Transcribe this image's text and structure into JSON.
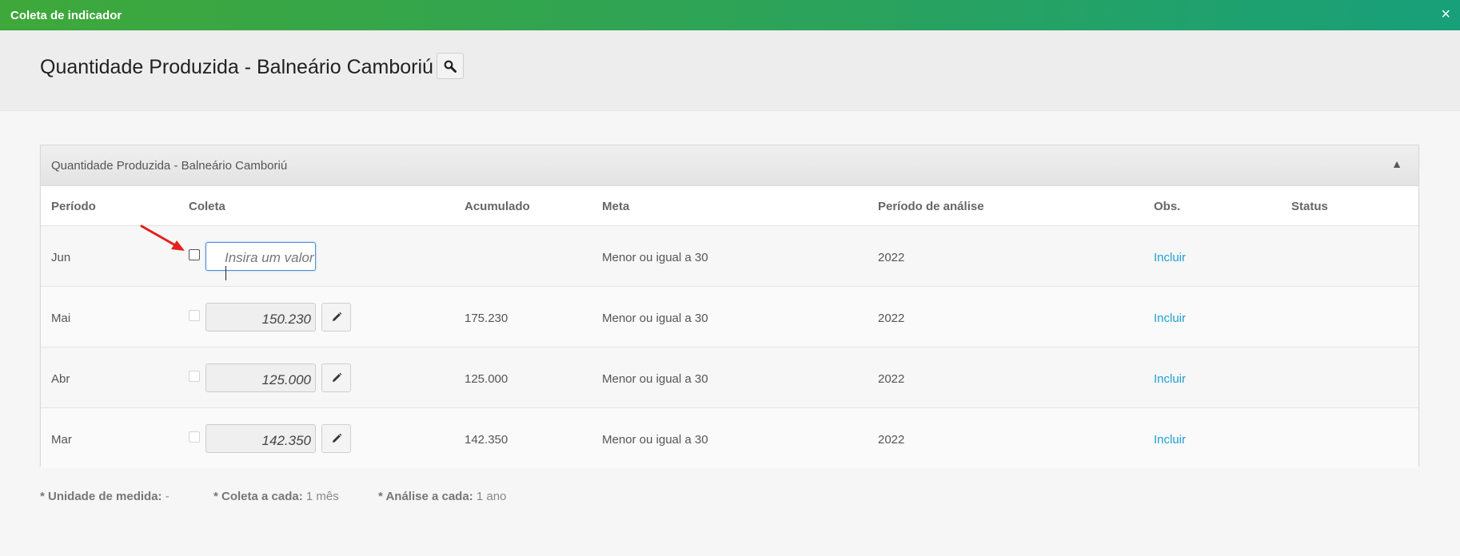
{
  "window": {
    "title": "Coleta de indicador",
    "close_icon": "×"
  },
  "page": {
    "title": "Quantidade Produzida - Balneário Camboriú"
  },
  "panel": {
    "title": "Quantidade Produzida - Balneário Camboriú",
    "collapse_icon": "▲",
    "columns": {
      "periodo": "Período",
      "coleta": "Coleta",
      "acumulado": "Acumulado",
      "meta": "Meta",
      "periodo_analise": "Período de análise",
      "obs": "Obs.",
      "status": "Status"
    },
    "rows": [
      {
        "periodo": "Jun",
        "coleta_placeholder": "Insira um valor",
        "coleta_value": "",
        "acumulado": "",
        "meta": "Menor ou igual a 30",
        "periodo_analise": "2022",
        "obs": "Incluir",
        "status": ""
      },
      {
        "periodo": "Mai",
        "coleta_value": "150.230",
        "acumulado": "175.230",
        "meta": "Menor ou igual a 30",
        "periodo_analise": "2022",
        "obs": "Incluir",
        "status": ""
      },
      {
        "periodo": "Abr",
        "coleta_value": "125.000",
        "acumulado": "125.000",
        "meta": "Menor ou igual a 30",
        "periodo_analise": "2022",
        "obs": "Incluir",
        "status": ""
      },
      {
        "periodo": "Mar",
        "coleta_value": "142.350",
        "acumulado": "142.350",
        "meta": "Menor ou igual a 30",
        "periodo_analise": "2022",
        "obs": "Incluir",
        "status": ""
      }
    ]
  },
  "footer": {
    "unidade_label": "* Unidade de medida:",
    "unidade_value": "-",
    "coleta_label": "* Coleta a cada:",
    "coleta_value": "1 mês",
    "analise_label": "* Análise a cada:",
    "analise_value": "1 ano"
  },
  "colors": {
    "accent_link": "#1ea0d2",
    "title_bar_start": "#3ea83a",
    "title_bar_end": "#18a07a",
    "annotation_arrow": "#e3201b"
  },
  "icons": {
    "search": "search-icon",
    "edit": "pencil-icon",
    "annotation": "red-arrow-icon"
  }
}
